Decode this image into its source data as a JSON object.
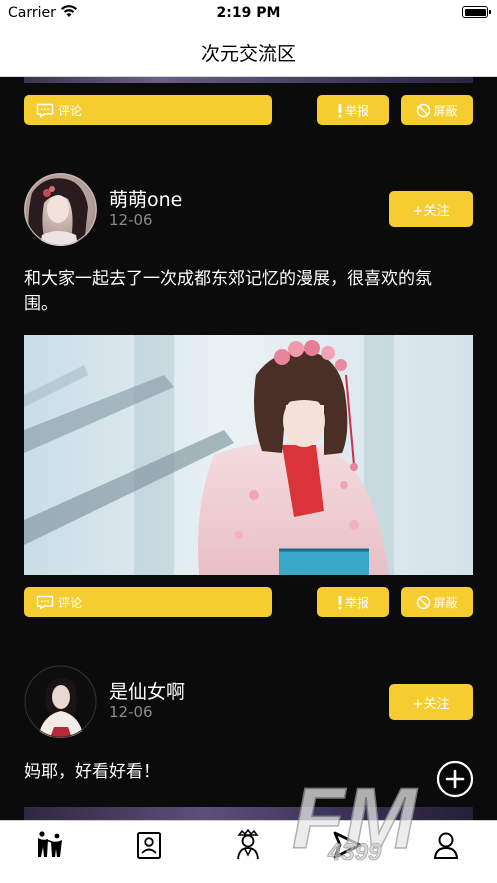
{
  "status_bar": {
    "carrier": "Carrier",
    "time": "2:19 PM"
  },
  "nav": {
    "title": "次元交流区"
  },
  "actions": {
    "comment_label": "评论",
    "report_label": "举报",
    "block_label": "屏蔽",
    "follow_label": "+关注"
  },
  "posts": [
    {
      "username": "萌萌one",
      "date": "12-06",
      "text": "和大家一起去了一次成都东郊记忆的漫展，很喜欢的氛围。"
    },
    {
      "username": "是仙女啊",
      "date": "12-06",
      "text": "妈耶，好看好看！"
    }
  ],
  "colors": {
    "accent": "#f5cd31",
    "background": "#0b0b0b",
    "muted_text": "#8a8a8a"
  },
  "icons": {
    "fab": "plus-circle-icon",
    "tabs": [
      "community-icon",
      "contacts-card-icon",
      "character-icon",
      "send-arrow-icon",
      "profile-icon"
    ]
  }
}
